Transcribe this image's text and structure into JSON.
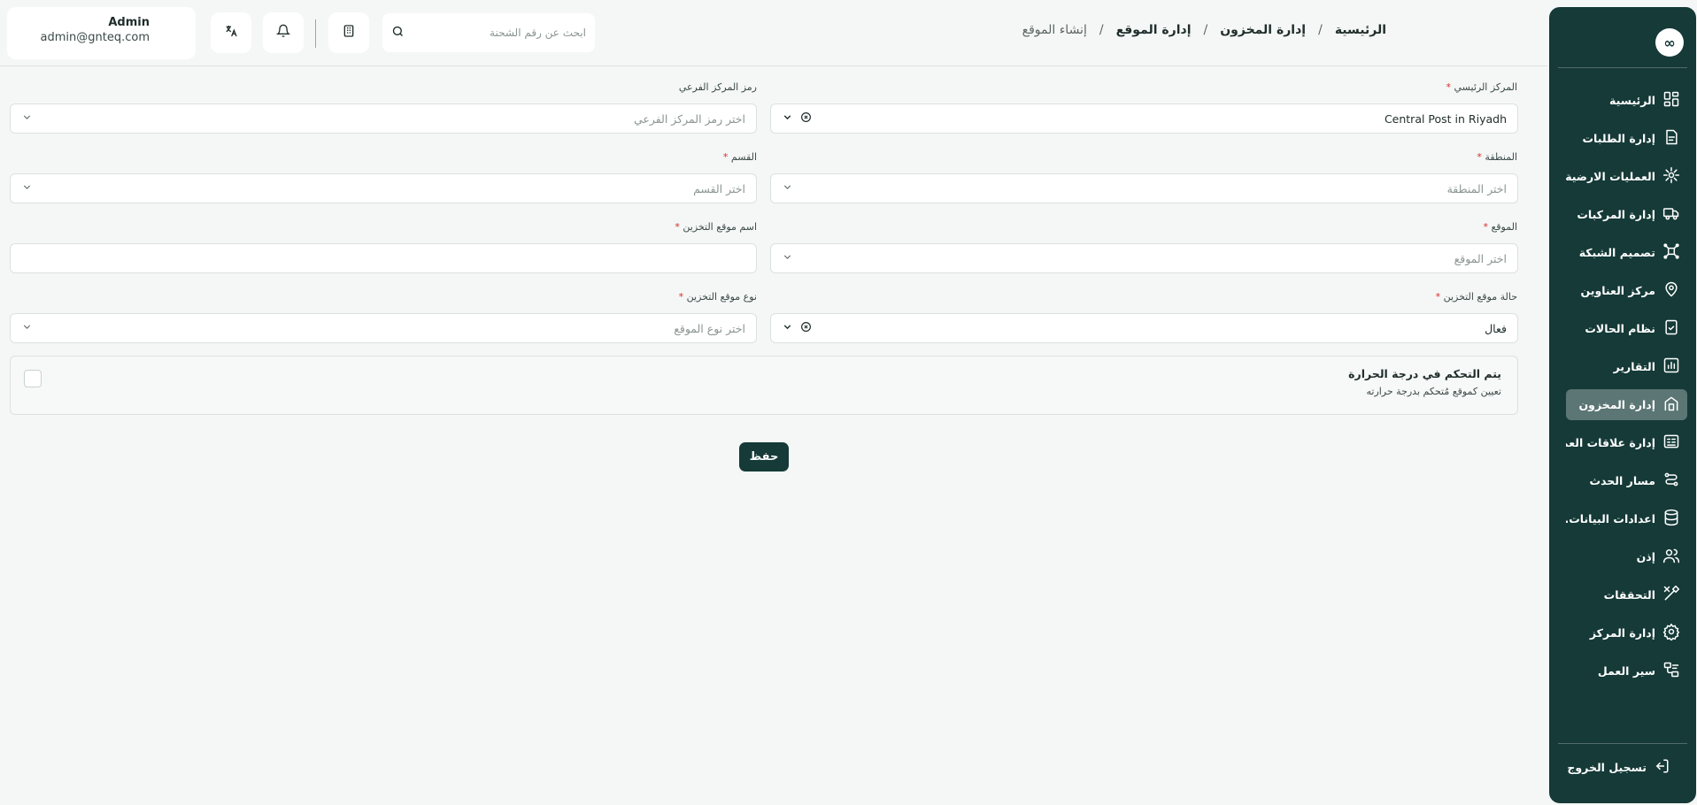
{
  "sidebar": {
    "logo": "∞",
    "items": [
      {
        "label": "الرئيسية",
        "icon": "dashboard-icon",
        "active": false
      },
      {
        "label": "إدارة الطلبات",
        "icon": "orders-icon",
        "active": false
      },
      {
        "label": "العمليات الارضية",
        "icon": "ground-ops-icon",
        "active": false
      },
      {
        "label": "إدارة المركبات",
        "icon": "truck-icon",
        "active": false
      },
      {
        "label": "تصميم الشبكة",
        "icon": "network-icon",
        "active": false
      },
      {
        "label": "مركز العناوين",
        "icon": "map-pin-icon",
        "active": false
      },
      {
        "label": "نظام الحالات",
        "icon": "status-icon",
        "active": false
      },
      {
        "label": "التقارير",
        "icon": "reports-icon",
        "active": false
      },
      {
        "label": "إدارة المخزون",
        "icon": "inventory-icon",
        "active": true
      },
      {
        "label": "إدارة علاقات العملاء",
        "icon": "crm-icon",
        "active": false
      },
      {
        "label": "مسار الحدث",
        "icon": "route-icon",
        "active": false
      },
      {
        "label": "اعدادات البيانات...",
        "icon": "database-icon",
        "active": false
      },
      {
        "label": "إذن",
        "icon": "users-icon",
        "active": false
      },
      {
        "label": "التحققات",
        "icon": "tools-icon",
        "active": false
      },
      {
        "label": "إدارة المركز",
        "icon": "center-gear-icon",
        "active": false
      },
      {
        "label": "سير العمل",
        "icon": "workflow-icon",
        "active": false
      }
    ],
    "logout_label": "تسجيل الخروج"
  },
  "header": {
    "user_name": "Admin",
    "user_email": "admin@gnteq.com",
    "search_placeholder": "ابحث عن رقم الشحنة",
    "breadcrumb": [
      "الرئيسية",
      "إدارة المخزون",
      "إدارة الموقع",
      "إنشاء الموقع"
    ],
    "breadcrumb_sep": "/"
  },
  "form": {
    "main_center": {
      "label": "المركز الرئيسي",
      "value": "Central Post in Riyadh"
    },
    "sub_center_code": {
      "label": "رمز المركز الفرعي",
      "placeholder": "اختر رمز المركز الفرعي"
    },
    "region": {
      "label": "المنطقة",
      "placeholder": "اختر المنطقة"
    },
    "section": {
      "label": "القسم",
      "placeholder": "اختر القسم"
    },
    "location": {
      "label": "الموقع",
      "placeholder": "اختر الموقع"
    },
    "storage_name": {
      "label": "اسم موقع التخزين",
      "value": ""
    },
    "storage_status": {
      "label": "حالة موقع التخزين",
      "value": "فعال"
    },
    "storage_type": {
      "label": "نوع موقع التخزين",
      "placeholder": "اختر نوع الموقع"
    },
    "required_mark": "*",
    "temperature": {
      "title": "يتم التحكم في درجة الحرارة",
      "description": "تعيين كموقع مُتحكم بدرجة حرارته",
      "checked": false
    },
    "save_label": "حفظ"
  },
  "colors": {
    "sidebar": "#153a38",
    "active_item": "#5b7674",
    "required": "#d62d2d",
    "background": "#f5f7f6"
  }
}
